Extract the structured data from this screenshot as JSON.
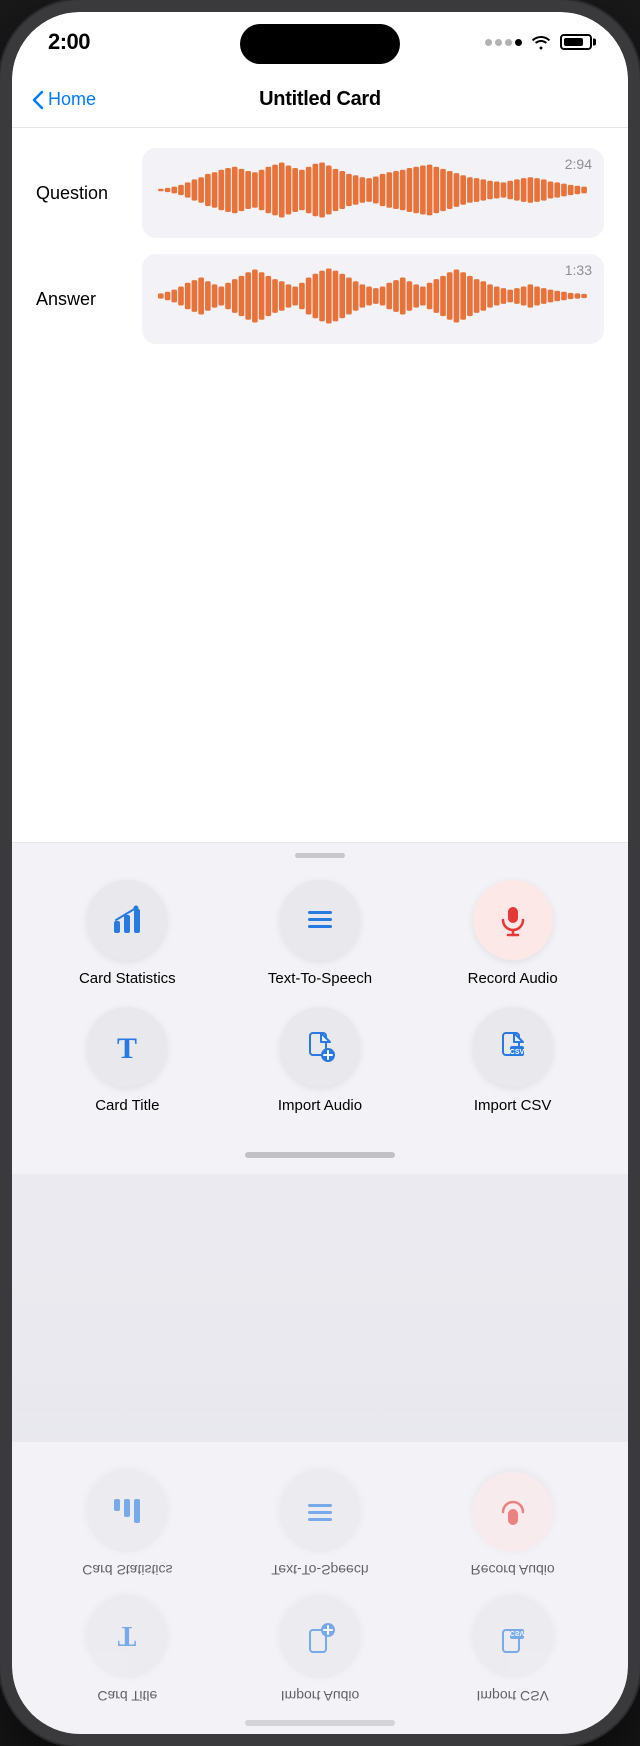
{
  "status": {
    "time": "2:00",
    "wifi": true,
    "battery_level": 80
  },
  "nav": {
    "back_label": "Home",
    "title": "Untitled Card"
  },
  "audio_sections": [
    {
      "label": "Question",
      "duration": "2:94",
      "waveform_bars": [
        3,
        5,
        8,
        12,
        18,
        25,
        30,
        38,
        42,
        48,
        52,
        55,
        50,
        45,
        42,
        48,
        55,
        60,
        65,
        58,
        52,
        48,
        55,
        62,
        65,
        58,
        50,
        45,
        38,
        35,
        30,
        28,
        32,
        38,
        42,
        45,
        48,
        52,
        55,
        58,
        60,
        55,
        50,
        45,
        40,
        35,
        30,
        28,
        25,
        22,
        20,
        18,
        22,
        25,
        28,
        30,
        28,
        25,
        20,
        18,
        15,
        12,
        10,
        8
      ]
    },
    {
      "label": "Answer",
      "duration": "1:33",
      "waveform_bars": [
        5,
        8,
        12,
        18,
        25,
        30,
        35,
        28,
        22,
        18,
        25,
        32,
        38,
        45,
        50,
        45,
        38,
        32,
        28,
        22,
        18,
        25,
        35,
        42,
        48,
        52,
        48,
        42,
        35,
        28,
        22,
        18,
        15,
        18,
        25,
        30,
        35,
        28,
        22,
        18,
        25,
        32,
        38,
        45,
        50,
        45,
        38,
        32,
        28,
        22,
        18,
        15,
        12,
        15,
        18,
        22,
        18,
        15,
        12,
        10,
        8,
        6,
        5,
        4
      ]
    }
  ],
  "actions": [
    {
      "id": "card-statistics",
      "label": "Card Statistics",
      "icon": "chart"
    },
    {
      "id": "text-to-speech",
      "label": "Text-To-Speech",
      "icon": "lines"
    },
    {
      "id": "record-audio",
      "label": "Record Audio",
      "icon": "microphone"
    },
    {
      "id": "card-title",
      "label": "Card Title",
      "icon": "letter-t"
    },
    {
      "id": "import-audio",
      "label": "Import Audio",
      "icon": "import-audio"
    },
    {
      "id": "import-csv",
      "label": "Import CSV",
      "icon": "csv"
    }
  ],
  "colors": {
    "accent_blue": "#007aff",
    "waveform_orange": "#e8733a",
    "icon_blue": "#2879e0"
  }
}
